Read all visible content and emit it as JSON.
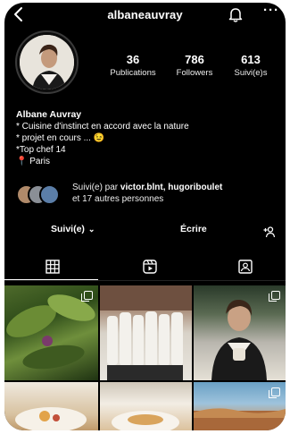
{
  "header": {
    "username": "albaneauvray",
    "back_icon": "chevron-left-icon",
    "bell_icon": "bell-icon",
    "more_label": "···"
  },
  "profile": {
    "stats": [
      {
        "value": "36",
        "label": "Publications"
      },
      {
        "value": "786",
        "label": "Followers"
      },
      {
        "value": "613",
        "label": "Suivi(e)s"
      }
    ],
    "name": "Albane Auvray",
    "bio_lines": [
      "* Cuisine d'instinct en accord avec la nature",
      "* projet en cours ... 😉",
      "*Top chef 14",
      "📍 Paris"
    ]
  },
  "followed_by": {
    "prefix": "Suivi(e) par ",
    "names": "victor.blnt, hugoriboulet",
    "suffix": "et 17 autres personnes"
  },
  "actions": {
    "follow_label": "Suivi(e)",
    "follow_chevron": "⌄",
    "message_label": "Écrire",
    "add_user_icon": "add-user-icon"
  },
  "tabs": [
    {
      "icon": "grid-icon"
    },
    {
      "icon": "reels-icon"
    },
    {
      "icon": "tagged-icon"
    }
  ],
  "colors": {
    "background": "#000000",
    "text": "#ffffff"
  }
}
